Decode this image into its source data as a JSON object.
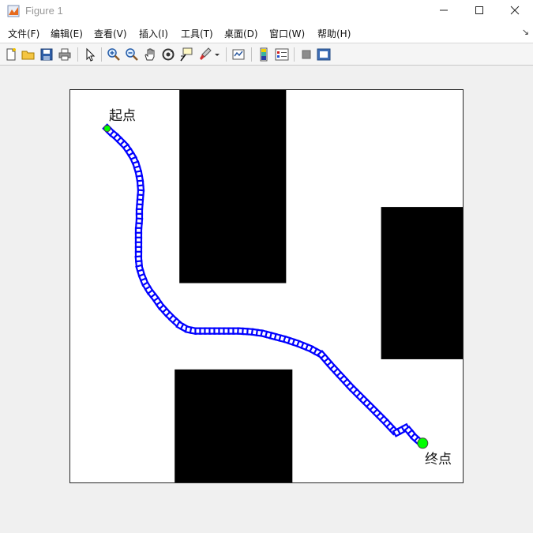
{
  "window": {
    "title": "Figure 1",
    "app_icon": "matlab-figure-icon",
    "controls": [
      "minimize-icon",
      "maximize-icon",
      "close-icon"
    ]
  },
  "menubar": {
    "items": [
      "文件(F)",
      "编辑(E)",
      "查看(V)",
      "插入(I)",
      "工具(T)",
      "桌面(D)",
      "窗口(W)",
      "帮助(H)"
    ]
  },
  "toolbar": {
    "buttons": [
      "new-figure-icon",
      "open-file-icon",
      "save-icon",
      "print-icon",
      "edit-plot-arrow-icon",
      "zoom-in-icon",
      "zoom-out-icon",
      "pan-hand-icon",
      "rotate-3d-icon",
      "data-cursor-icon",
      "brush-icon",
      "link-plot-icon",
      "colorbar-icon",
      "legend-icon",
      "hide-plot-tools-icon",
      "show-plot-tools-icon"
    ]
  },
  "annotations": {
    "start_label": "起点",
    "end_label": "终点"
  },
  "colors": {
    "path": "#0000ff",
    "marker": "#00ff00",
    "obstacle": "#000000"
  },
  "chart_data": {
    "type": "scatter",
    "title": "",
    "xlabel": "",
    "ylabel": "",
    "xlim": [
      0,
      500
    ],
    "ylim": [
      0,
      500
    ],
    "grid": false,
    "axis_ticks": false,
    "obstacles": [
      {
        "x": [
          139,
          275
        ],
        "y": [
          254,
          500
        ]
      },
      {
        "x": [
          396,
          500
        ],
        "y": [
          157,
          351
        ]
      },
      {
        "x": [
          133,
          283
        ],
        "y": [
          0,
          144
        ]
      }
    ],
    "path": {
      "marker": "square",
      "x": [
        47,
        52,
        58,
        64,
        70,
        75,
        80,
        84,
        87,
        89,
        90,
        89,
        88,
        88,
        87,
        87,
        87,
        87,
        88,
        91,
        95,
        101,
        108,
        115,
        123,
        131,
        140,
        149,
        159,
        171,
        185,
        200,
        215,
        230,
        245,
        260,
        275,
        290,
        305,
        320,
        333,
        345,
        357,
        372,
        387,
        402,
        415,
        428,
        438,
        447
      ],
      "y": [
        451,
        446,
        441,
        435,
        429,
        422,
        414,
        405,
        395,
        384,
        372,
        360,
        347,
        335,
        322,
        309,
        297,
        285,
        274,
        264,
        254,
        244,
        235,
        225,
        216,
        208,
        200,
        195,
        193,
        193,
        193,
        193,
        193,
        192,
        190,
        186,
        182,
        177,
        171,
        163,
        148,
        135,
        122,
        107,
        92,
        77,
        63,
        70,
        58,
        50
      ]
    },
    "start_point": {
      "x": 47,
      "y": 451,
      "label": "起点"
    },
    "end_point": {
      "x": 449,
      "y": 50,
      "label": "终点"
    }
  }
}
